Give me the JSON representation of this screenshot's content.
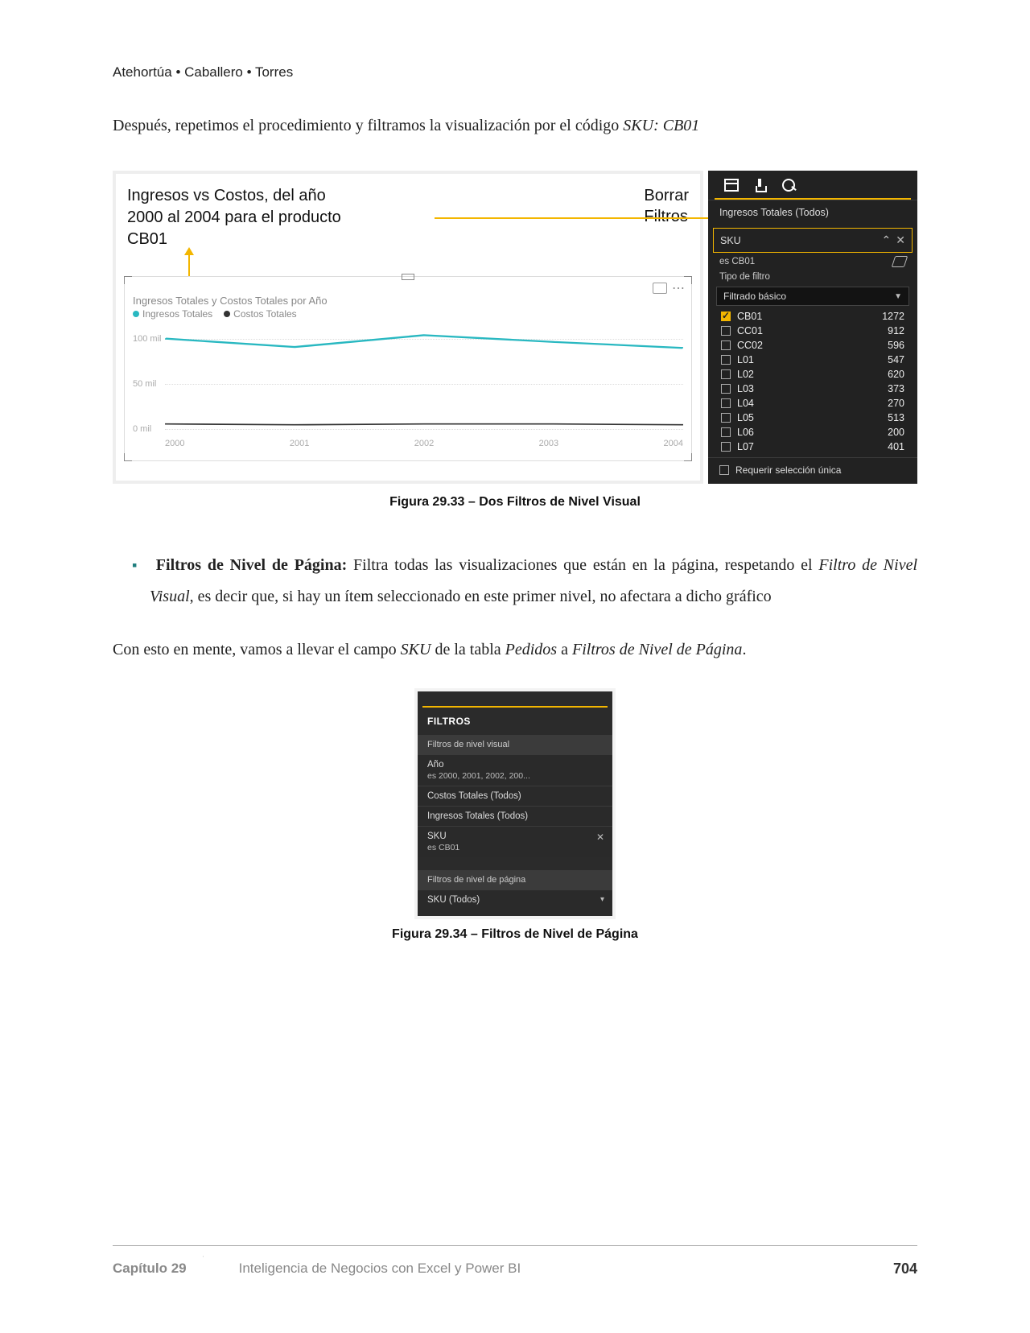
{
  "header": {
    "authors": "Atehortúa • Caballero • Torres"
  },
  "intro": {
    "text_pre": "Después, repetimos el procedimiento y filtramos la visualización por el código ",
    "text_em": "SKU: CB01"
  },
  "fig33": {
    "annot_left": "Ingresos vs Costos, del año 2000 al 2004 para el producto CB01",
    "annot_right_l1": "Borrar",
    "annot_right_l2": "Filtros",
    "chart_title": "Ingresos Totales y Costos Totales por Año",
    "legend_ing": "Ingresos Totales",
    "legend_cost": "Costos Totales",
    "caption": "Figura 29.33 –  Dos Filtros de Nivel Visual"
  },
  "chart_data": {
    "type": "line",
    "title": "Ingresos Totales y Costos Totales por Año",
    "xlabel": "Año",
    "ylabel": "",
    "y_ticks": [
      "100 mil",
      "50 mil",
      "0 mil"
    ],
    "categories": [
      "2000",
      "2001",
      "2002",
      "2003",
      "2004"
    ],
    "ylim": [
      0,
      120
    ],
    "series": [
      {
        "name": "Ingresos Totales",
        "color": "#29b8c1",
        "values": [
          108,
          98,
          112,
          104,
          97
        ]
      },
      {
        "name": "Costos Totales",
        "color": "#333333",
        "values": [
          7,
          6,
          7,
          7,
          6
        ]
      }
    ]
  },
  "panel33": {
    "row1": "Ingresos Totales (Todos)",
    "sku_label": "SKU",
    "es_label": "es CB01",
    "tipo_label": "Tipo de filtro",
    "select_label": "Filtrado básico",
    "rows": [
      {
        "name": "CB01",
        "count": "1272",
        "checked": true
      },
      {
        "name": "CC01",
        "count": "912",
        "checked": false
      },
      {
        "name": "CC02",
        "count": "596",
        "checked": false
      },
      {
        "name": "L01",
        "count": "547",
        "checked": false
      },
      {
        "name": "L02",
        "count": "620",
        "checked": false
      },
      {
        "name": "L03",
        "count": "373",
        "checked": false
      },
      {
        "name": "L04",
        "count": "270",
        "checked": false
      },
      {
        "name": "L05",
        "count": "513",
        "checked": false
      },
      {
        "name": "L06",
        "count": "200",
        "checked": false
      },
      {
        "name": "L07",
        "count": "401",
        "checked": false
      }
    ],
    "footer": "Requerir selección única"
  },
  "bullet": {
    "bold": "Filtros de Nivel de Página:",
    "rest1": " Filtra todas las visualizaciones que están en la página, respetando el ",
    "em": "Filtro de Nivel Visual",
    "rest2": ", es decir que, si hay un ítem seleccionado en este primer nivel, no afectara a dicho gráfico"
  },
  "para2": {
    "t1": "Con esto en mente, vamos a llevar el campo ",
    "sku": "SKU",
    "t2": " de la tabla ",
    "ped": "Pedidos",
    "t3": " a ",
    "fnp": "Filtros de Nivel de Página",
    "t4": "."
  },
  "panel34": {
    "heading": "FILTROS",
    "sect_visual": "Filtros de nivel visual",
    "row_anio_label": "Año",
    "row_anio_sub": "es 2000, 2001, 2002, 200...",
    "row_costos": "Costos Totales (Todos)",
    "row_ingresos": "Ingresos Totales (Todos)",
    "row_sku_label": "SKU",
    "row_sku_sub": "es CB01",
    "sect_pagina": "Filtros de nivel de página",
    "row_sku_todos": "SKU (Todos)",
    "caption": "Figura 29.34 –  Filtros de Nivel de Página"
  },
  "footer": {
    "chapter": "Capítulo 29",
    "title": "Inteligencia de Negocios con Excel y Power BI",
    "page": "704"
  }
}
